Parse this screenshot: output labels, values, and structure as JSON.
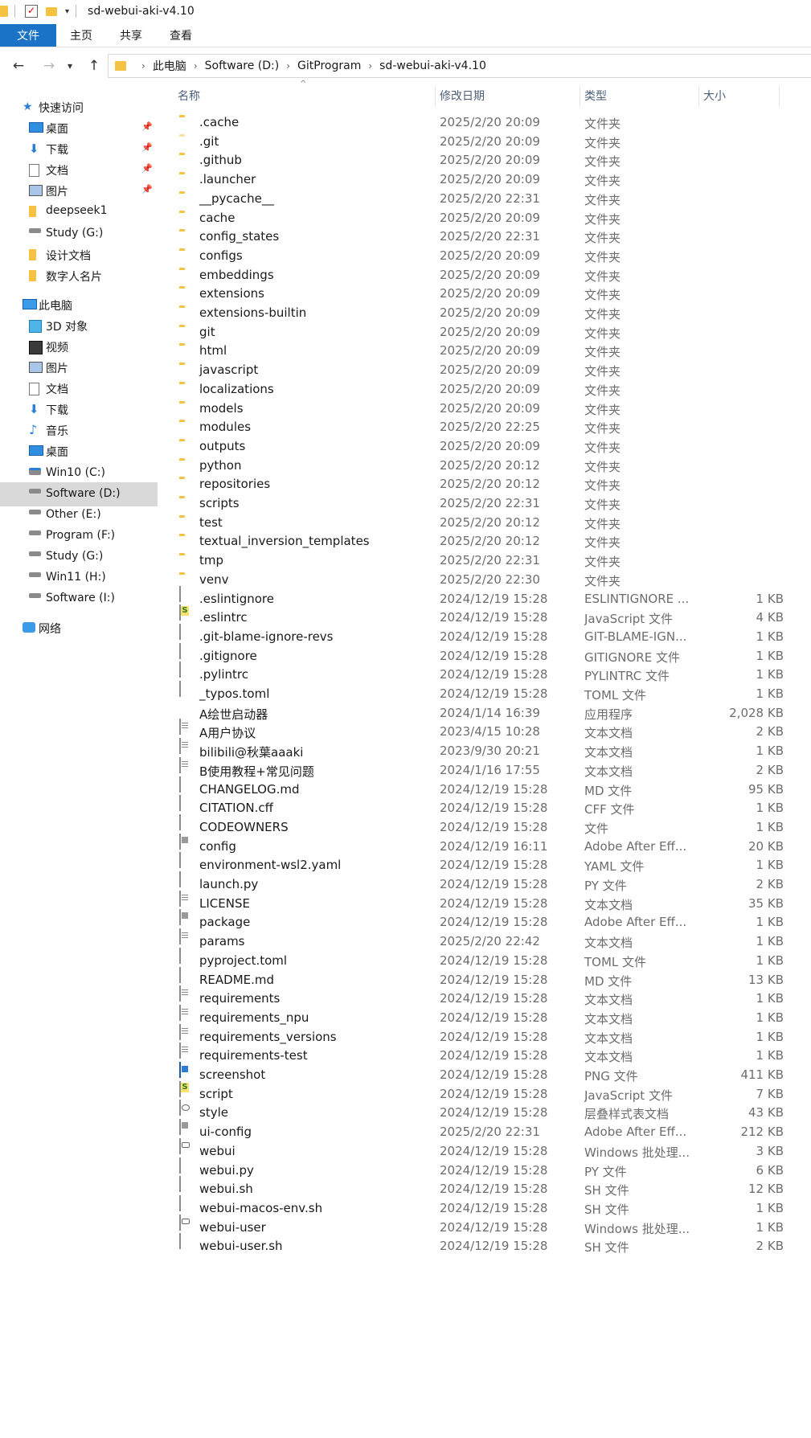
{
  "window": {
    "title": "sd-webui-aki-v4.10"
  },
  "ribbon": {
    "tabs": [
      "文件",
      "主页",
      "共享",
      "查看"
    ]
  },
  "address": {
    "crumbs": [
      "此电脑",
      "Software (D:)",
      "GitProgram",
      "sd-webui-aki-v4.10"
    ]
  },
  "nav": {
    "items": [
      {
        "label": "快速访问",
        "icon": "star-icon",
        "pinned": false
      },
      {
        "label": "桌面",
        "icon": "desktop-icon",
        "pinned": true
      },
      {
        "label": "下载",
        "icon": "download-icon",
        "pinned": true
      },
      {
        "label": "文档",
        "icon": "documents-icon",
        "pinned": true
      },
      {
        "label": "图片",
        "icon": "pictures-icon",
        "pinned": true
      },
      {
        "label": "deepseek1",
        "icon": "folder-icon",
        "pinned": false
      },
      {
        "label": "Study (G:)",
        "icon": "drive-icon",
        "pinned": false
      },
      {
        "label": "设计文档",
        "icon": "folder-icon",
        "pinned": false
      },
      {
        "label": "数字人名片",
        "icon": "folder-icon",
        "pinned": false
      },
      {
        "label": "此电脑",
        "icon": "computer-icon",
        "pinned": false
      },
      {
        "label": "3D 对象",
        "icon": "3d-objects-icon",
        "pinned": false
      },
      {
        "label": "视频",
        "icon": "video-icon",
        "pinned": false
      },
      {
        "label": "图片",
        "icon": "pictures-icon",
        "pinned": false
      },
      {
        "label": "文档",
        "icon": "documents-icon",
        "pinned": false
      },
      {
        "label": "下载",
        "icon": "download-icon",
        "pinned": false
      },
      {
        "label": "音乐",
        "icon": "music-icon",
        "pinned": false
      },
      {
        "label": "桌面",
        "icon": "desktop-icon",
        "pinned": false
      },
      {
        "label": "Win10 (C:)",
        "icon": "system-drive-icon",
        "pinned": false
      },
      {
        "label": "Software (D:)",
        "icon": "drive-icon",
        "pinned": false,
        "selected": true
      },
      {
        "label": "Other (E:)",
        "icon": "drive-icon",
        "pinned": false
      },
      {
        "label": "Program (F:)",
        "icon": "drive-icon",
        "pinned": false
      },
      {
        "label": "Study (G:)",
        "icon": "drive-icon",
        "pinned": false
      },
      {
        "label": "Win11 (H:)",
        "icon": "drive-icon",
        "pinned": false
      },
      {
        "label": "Software (I:)",
        "icon": "drive-icon",
        "pinned": false
      },
      {
        "label": "网络",
        "icon": "network-icon",
        "pinned": false
      }
    ]
  },
  "columns": {
    "name": "名称",
    "date": "修改日期",
    "type": "类型",
    "size": "大小"
  },
  "files": [
    {
      "name": ".cache",
      "date": "2025/2/20 20:09",
      "type": "文件夹",
      "size": "",
      "icon": "folder"
    },
    {
      "name": ".git",
      "date": "2025/2/20 20:09",
      "type": "文件夹",
      "size": "",
      "icon": "folder-hidden"
    },
    {
      "name": ".github",
      "date": "2025/2/20 20:09",
      "type": "文件夹",
      "size": "",
      "icon": "folder"
    },
    {
      "name": ".launcher",
      "date": "2025/2/20 20:09",
      "type": "文件夹",
      "size": "",
      "icon": "folder"
    },
    {
      "name": "__pycache__",
      "date": "2025/2/20 22:31",
      "type": "文件夹",
      "size": "",
      "icon": "folder"
    },
    {
      "name": "cache",
      "date": "2025/2/20 20:09",
      "type": "文件夹",
      "size": "",
      "icon": "folder"
    },
    {
      "name": "config_states",
      "date": "2025/2/20 22:31",
      "type": "文件夹",
      "size": "",
      "icon": "folder"
    },
    {
      "name": "configs",
      "date": "2025/2/20 20:09",
      "type": "文件夹",
      "size": "",
      "icon": "folder"
    },
    {
      "name": "embeddings",
      "date": "2025/2/20 20:09",
      "type": "文件夹",
      "size": "",
      "icon": "folder"
    },
    {
      "name": "extensions",
      "date": "2025/2/20 20:09",
      "type": "文件夹",
      "size": "",
      "icon": "folder"
    },
    {
      "name": "extensions-builtin",
      "date": "2025/2/20 20:09",
      "type": "文件夹",
      "size": "",
      "icon": "folder"
    },
    {
      "name": "git",
      "date": "2025/2/20 20:09",
      "type": "文件夹",
      "size": "",
      "icon": "folder"
    },
    {
      "name": "html",
      "date": "2025/2/20 20:09",
      "type": "文件夹",
      "size": "",
      "icon": "folder"
    },
    {
      "name": "javascript",
      "date": "2025/2/20 20:09",
      "type": "文件夹",
      "size": "",
      "icon": "folder"
    },
    {
      "name": "localizations",
      "date": "2025/2/20 20:09",
      "type": "文件夹",
      "size": "",
      "icon": "folder"
    },
    {
      "name": "models",
      "date": "2025/2/20 20:09",
      "type": "文件夹",
      "size": "",
      "icon": "folder"
    },
    {
      "name": "modules",
      "date": "2025/2/20 22:25",
      "type": "文件夹",
      "size": "",
      "icon": "folder"
    },
    {
      "name": "outputs",
      "date": "2025/2/20 20:09",
      "type": "文件夹",
      "size": "",
      "icon": "folder"
    },
    {
      "name": "python",
      "date": "2025/2/20 20:12",
      "type": "文件夹",
      "size": "",
      "icon": "folder"
    },
    {
      "name": "repositories",
      "date": "2025/2/20 20:12",
      "type": "文件夹",
      "size": "",
      "icon": "folder"
    },
    {
      "name": "scripts",
      "date": "2025/2/20 22:31",
      "type": "文件夹",
      "size": "",
      "icon": "folder"
    },
    {
      "name": "test",
      "date": "2025/2/20 20:12",
      "type": "文件夹",
      "size": "",
      "icon": "folder"
    },
    {
      "name": "textual_inversion_templates",
      "date": "2025/2/20 20:12",
      "type": "文件夹",
      "size": "",
      "icon": "folder"
    },
    {
      "name": "tmp",
      "date": "2025/2/20 22:31",
      "type": "文件夹",
      "size": "",
      "icon": "folder"
    },
    {
      "name": "venv",
      "date": "2025/2/20 22:30",
      "type": "文件夹",
      "size": "",
      "icon": "folder"
    },
    {
      "name": ".eslintignore",
      "date": "2024/12/19 15:28",
      "type": "ESLINTIGNORE ...",
      "size": "1 KB",
      "icon": "file"
    },
    {
      "name": ".eslintrc",
      "date": "2024/12/19 15:28",
      "type": "JavaScript 文件",
      "size": "4 KB",
      "icon": "js"
    },
    {
      "name": ".git-blame-ignore-revs",
      "date": "2024/12/19 15:28",
      "type": "GIT-BLAME-IGN...",
      "size": "1 KB",
      "icon": "file"
    },
    {
      "name": ".gitignore",
      "date": "2024/12/19 15:28",
      "type": "GITIGNORE 文件",
      "size": "1 KB",
      "icon": "file"
    },
    {
      "name": ".pylintrc",
      "date": "2024/12/19 15:28",
      "type": "PYLINTRC 文件",
      "size": "1 KB",
      "icon": "file"
    },
    {
      "name": "_typos.toml",
      "date": "2024/12/19 15:28",
      "type": "TOML 文件",
      "size": "1 KB",
      "icon": "file"
    },
    {
      "name": "A绘世启动器",
      "date": "2024/1/14 16:39",
      "type": "应用程序",
      "size": "2,028 KB",
      "icon": "app"
    },
    {
      "name": "A用户协议",
      "date": "2023/4/15 10:28",
      "type": "文本文档",
      "size": "2 KB",
      "icon": "txt"
    },
    {
      "name": "bilibili@秋葉aaaki",
      "date": "2023/9/30 20:21",
      "type": "文本文档",
      "size": "1 KB",
      "icon": "txt"
    },
    {
      "name": "B使用教程+常见问题",
      "date": "2024/1/16 17:55",
      "type": "文本文档",
      "size": "2 KB",
      "icon": "txt"
    },
    {
      "name": "CHANGELOG.md",
      "date": "2024/12/19 15:28",
      "type": "MD 文件",
      "size": "95 KB",
      "icon": "file"
    },
    {
      "name": "CITATION.cff",
      "date": "2024/12/19 15:28",
      "type": "CFF 文件",
      "size": "1 KB",
      "icon": "file"
    },
    {
      "name": "CODEOWNERS",
      "date": "2024/12/19 15:28",
      "type": "文件",
      "size": "1 KB",
      "icon": "file"
    },
    {
      "name": "config",
      "date": "2024/12/19 16:11",
      "type": "Adobe After Eff...",
      "size": "20 KB",
      "icon": "ae"
    },
    {
      "name": "environment-wsl2.yaml",
      "date": "2024/12/19 15:28",
      "type": "YAML 文件",
      "size": "1 KB",
      "icon": "file"
    },
    {
      "name": "launch.py",
      "date": "2024/12/19 15:28",
      "type": "PY 文件",
      "size": "2 KB",
      "icon": "file"
    },
    {
      "name": "LICENSE",
      "date": "2024/12/19 15:28",
      "type": "文本文档",
      "size": "35 KB",
      "icon": "txt"
    },
    {
      "name": "package",
      "date": "2024/12/19 15:28",
      "type": "Adobe After Eff...",
      "size": "1 KB",
      "icon": "ae"
    },
    {
      "name": "params",
      "date": "2025/2/20 22:42",
      "type": "文本文档",
      "size": "1 KB",
      "icon": "txt"
    },
    {
      "name": "pyproject.toml",
      "date": "2024/12/19 15:28",
      "type": "TOML 文件",
      "size": "1 KB",
      "icon": "file"
    },
    {
      "name": "README.md",
      "date": "2024/12/19 15:28",
      "type": "MD 文件",
      "size": "13 KB",
      "icon": "file"
    },
    {
      "name": "requirements",
      "date": "2024/12/19 15:28",
      "type": "文本文档",
      "size": "1 KB",
      "icon": "txt"
    },
    {
      "name": "requirements_npu",
      "date": "2024/12/19 15:28",
      "type": "文本文档",
      "size": "1 KB",
      "icon": "txt"
    },
    {
      "name": "requirements_versions",
      "date": "2024/12/19 15:28",
      "type": "文本文档",
      "size": "1 KB",
      "icon": "txt"
    },
    {
      "name": "requirements-test",
      "date": "2024/12/19 15:28",
      "type": "文本文档",
      "size": "1 KB",
      "icon": "txt"
    },
    {
      "name": "screenshot",
      "date": "2024/12/19 15:28",
      "type": "PNG 文件",
      "size": "411 KB",
      "icon": "png"
    },
    {
      "name": "script",
      "date": "2024/12/19 15:28",
      "type": "JavaScript 文件",
      "size": "7 KB",
      "icon": "js"
    },
    {
      "name": "style",
      "date": "2024/12/19 15:28",
      "type": "层叠样式表文档",
      "size": "43 KB",
      "icon": "css"
    },
    {
      "name": "ui-config",
      "date": "2025/2/20 22:31",
      "type": "Adobe After Eff...",
      "size": "212 KB",
      "icon": "ae"
    },
    {
      "name": "webui",
      "date": "2024/12/19 15:28",
      "type": "Windows 批处理...",
      "size": "3 KB",
      "icon": "bat"
    },
    {
      "name": "webui.py",
      "date": "2024/12/19 15:28",
      "type": "PY 文件",
      "size": "6 KB",
      "icon": "file"
    },
    {
      "name": "webui.sh",
      "date": "2024/12/19 15:28",
      "type": "SH 文件",
      "size": "12 KB",
      "icon": "file"
    },
    {
      "name": "webui-macos-env.sh",
      "date": "2024/12/19 15:28",
      "type": "SH 文件",
      "size": "1 KB",
      "icon": "file"
    },
    {
      "name": "webui-user",
      "date": "2024/12/19 15:28",
      "type": "Windows 批处理...",
      "size": "1 KB",
      "icon": "bat"
    },
    {
      "name": "webui-user.sh",
      "date": "2024/12/19 15:28",
      "type": "SH 文件",
      "size": "2 KB",
      "icon": "file"
    }
  ]
}
